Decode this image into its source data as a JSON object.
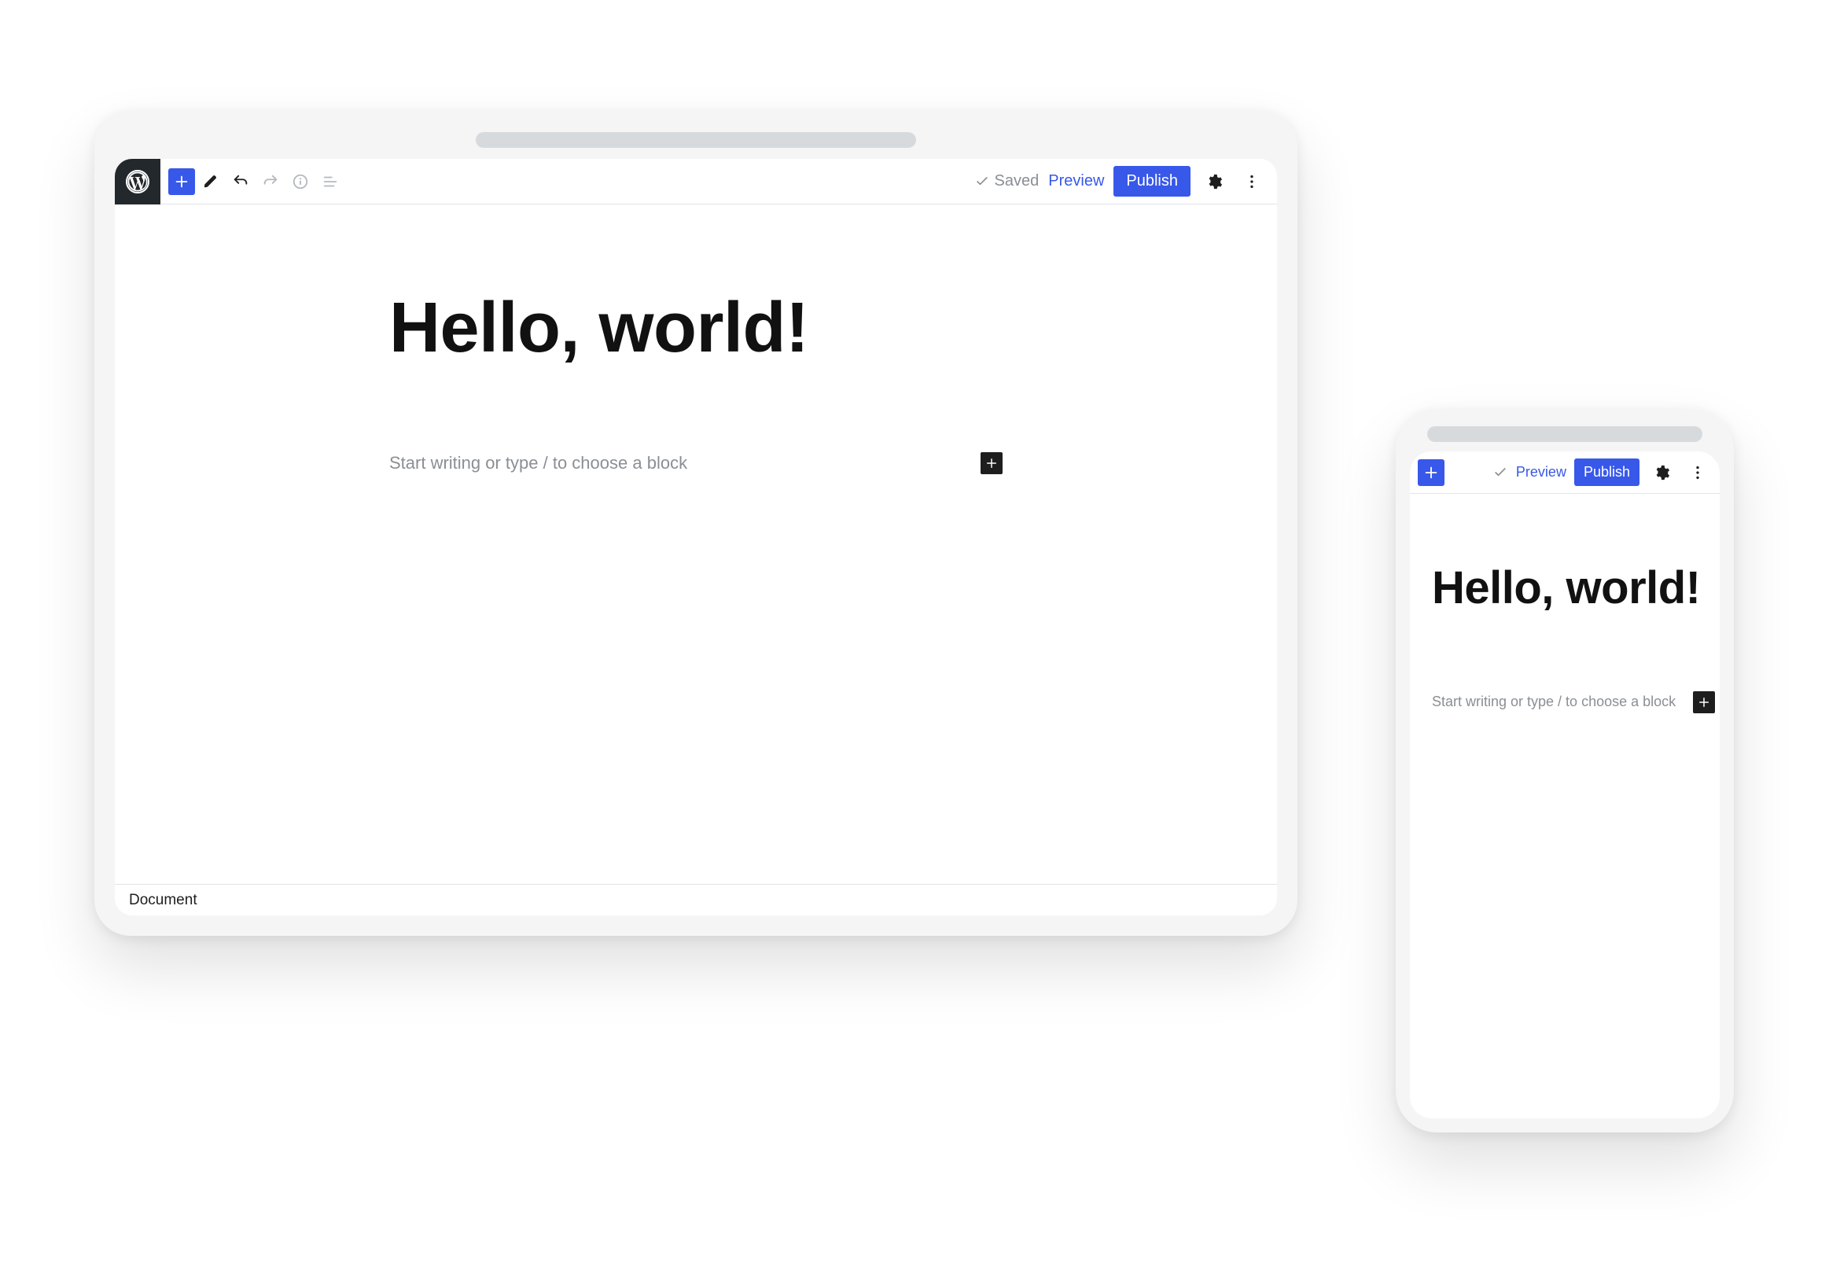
{
  "desktop": {
    "toolbar": {
      "saved_label": "Saved",
      "preview_label": "Preview",
      "publish_label": "Publish"
    },
    "editor": {
      "title": "Hello, world!",
      "block_placeholder": "Start writing or type / to choose a block"
    },
    "footer": {
      "breadcrumb": "Document"
    }
  },
  "mobile": {
    "toolbar": {
      "preview_label": "Preview",
      "publish_label": "Publish"
    },
    "editor": {
      "title": "Hello, world!",
      "block_placeholder": "Start writing or type / to choose a block"
    }
  },
  "colors": {
    "primary": "#3858e9",
    "logo_bg": "#23282d",
    "muted_text": "#8a8f94",
    "border": "#e2e4e7"
  }
}
